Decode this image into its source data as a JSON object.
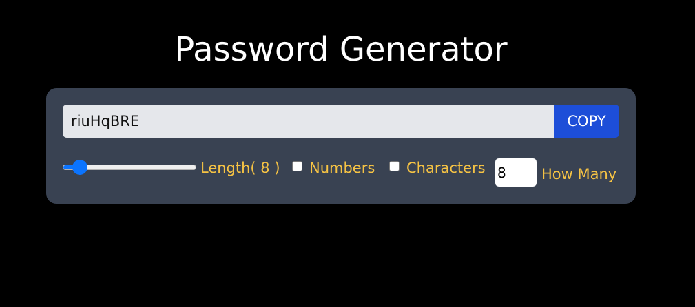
{
  "title": "Password Generator",
  "password": {
    "value": "riuHqBRE"
  },
  "copy_button": {
    "label": "COPY"
  },
  "length": {
    "label": "Length( 8 )",
    "value": 8,
    "fill_fraction": 0.13
  },
  "numbers": {
    "label": "Numbers",
    "checked": false
  },
  "characters": {
    "label": "Characters",
    "checked": false
  },
  "how_many": {
    "value": "8",
    "label": "How Many"
  },
  "colors": {
    "background": "#000000",
    "card": "#394252",
    "accent_blue": "#1d4ed8",
    "label_yellow": "#f6c344"
  }
}
